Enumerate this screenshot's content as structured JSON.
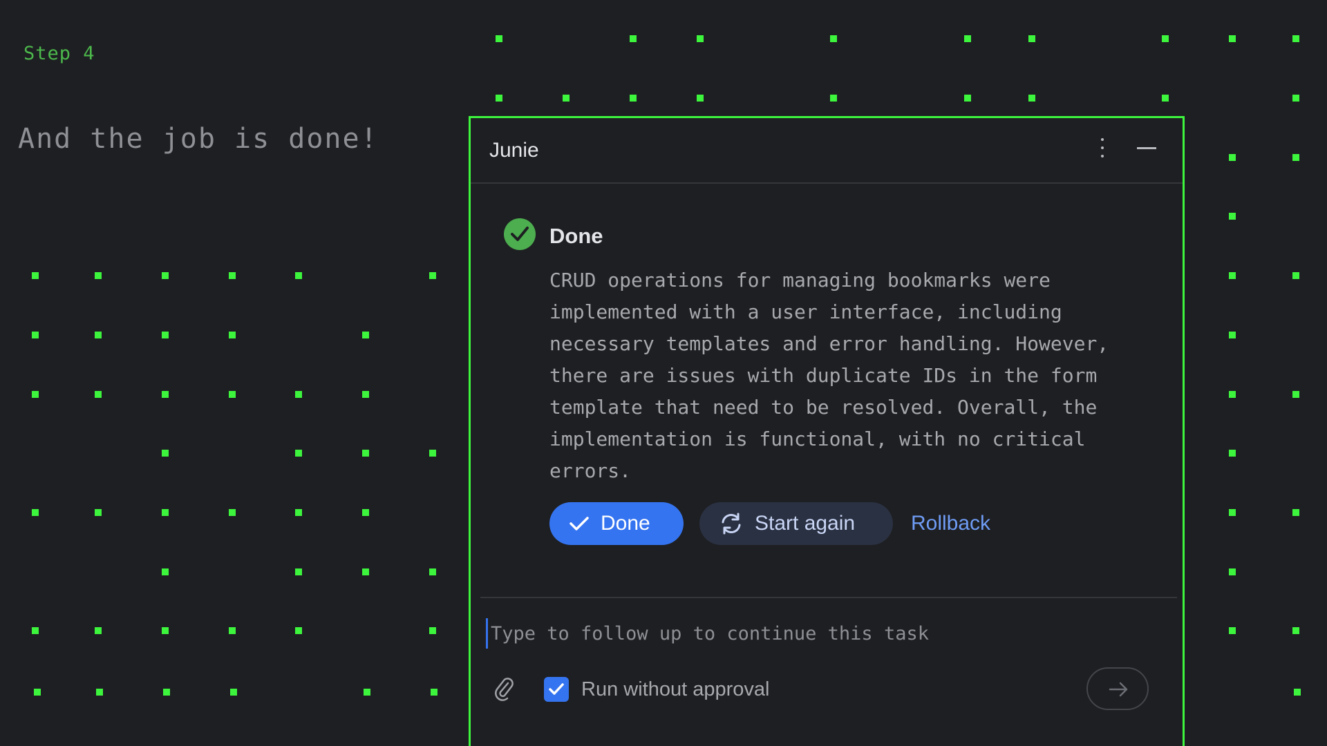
{
  "intro": {
    "step_label": "Step 4",
    "headline": "And the job is done!"
  },
  "panel": {
    "title": "Junie",
    "menu_icon": "kebab-menu-icon",
    "minimize_icon": "minimize-icon"
  },
  "status": {
    "icon": "check-circle-icon",
    "label": "Done",
    "summary": "CRUD operations for managing bookmarks were\nimplemented with a user interface, including\nnecessary templates and error handling. However,\nthere are issues with duplicate IDs in the form\ntemplate that need to be resolved. Overall, the\nimplementation is functional, with no critical\nerrors."
  },
  "actions": {
    "done_label": "Done",
    "start_again_label": "Start again",
    "rollback_label": "Rollback"
  },
  "composer": {
    "value": "",
    "placeholder": "Type to follow up to continue this task",
    "attach_icon": "paperclip-icon",
    "run_without_approval_label": "Run without approval",
    "run_without_approval_checked": true,
    "send_icon": "arrow-right-icon"
  },
  "colors": {
    "background": "#1e1f22",
    "accent_green": "#3df53d",
    "primary_blue": "#3574f0",
    "success_green": "#4cae4f"
  }
}
